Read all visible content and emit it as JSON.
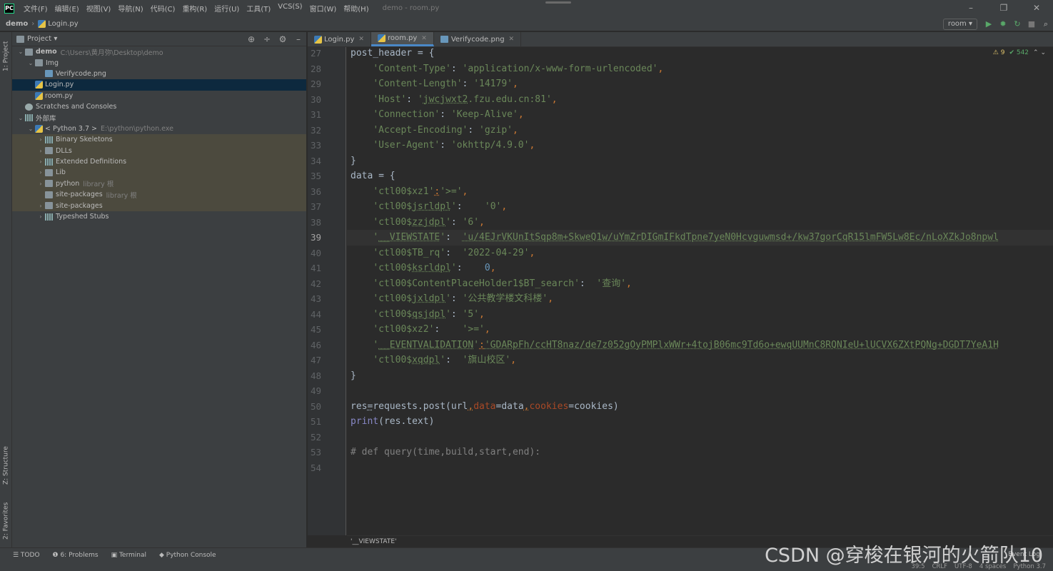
{
  "window": {
    "title": "demo - room.py",
    "menu": [
      "文件(F)",
      "编辑(E)",
      "视图(V)",
      "导航(N)",
      "代码(C)",
      "重构(R)",
      "运行(U)",
      "工具(T)",
      "VCS(S)",
      "窗口(W)",
      "帮助(H)"
    ],
    "controls": [
      "–",
      "❐",
      "✕"
    ]
  },
  "breadcrumb": {
    "project": "demo",
    "file": "Login.py"
  },
  "run": {
    "config": "room ▾",
    "buttons": [
      "▶",
      "✹",
      "↻",
      "■",
      "⌕"
    ]
  },
  "left_strip": {
    "project": "1: Project",
    "structure": "Z: Structure",
    "favorites": "2: Favorites"
  },
  "project_panel": {
    "title": "Project ▾",
    "tools": [
      "⊕",
      "÷",
      "⚙",
      "–"
    ],
    "tree": [
      {
        "indent": 0,
        "arrow": "⌄",
        "icon": "folder",
        "label": "demo",
        "path": "C:\\Users\\黄月弥\\Desktop\\demo",
        "bold": true,
        "style": ""
      },
      {
        "indent": 1,
        "arrow": "⌄",
        "icon": "folder",
        "label": "Img",
        "path": "",
        "style": ""
      },
      {
        "indent": 2,
        "arrow": "",
        "icon": "png",
        "label": "Verifycode.png",
        "path": "",
        "style": ""
      },
      {
        "indent": 1,
        "arrow": "",
        "icon": "py",
        "label": "Login.py",
        "path": "",
        "style": "selected"
      },
      {
        "indent": 1,
        "arrow": "",
        "icon": "py",
        "label": "room.py",
        "path": "",
        "style": ""
      },
      {
        "indent": 0,
        "arrow": "",
        "icon": "scratch",
        "label": "Scratches and Consoles",
        "path": "",
        "style": ""
      },
      {
        "indent": 0,
        "arrow": "⌄",
        "icon": "lib",
        "label": "外部库",
        "path": "",
        "style": ""
      },
      {
        "indent": 1,
        "arrow": "⌄",
        "icon": "py",
        "label": "< Python 3.7 >",
        "path": "E:\\python\\python.exe",
        "style": ""
      },
      {
        "indent": 2,
        "arrow": "›",
        "icon": "lib",
        "label": "Binary Skeletons",
        "path": "",
        "style": "lib"
      },
      {
        "indent": 2,
        "arrow": "›",
        "icon": "folder",
        "label": "DLLs",
        "path": "",
        "style": "lib"
      },
      {
        "indent": 2,
        "arrow": "›",
        "icon": "lib",
        "label": "Extended Definitions",
        "path": "",
        "style": "lib"
      },
      {
        "indent": 2,
        "arrow": "›",
        "icon": "folder",
        "label": "Lib",
        "path": "",
        "style": "lib"
      },
      {
        "indent": 2,
        "arrow": "›",
        "icon": "folder",
        "label": "python",
        "path": "library 根",
        "style": "lib"
      },
      {
        "indent": 2,
        "arrow": "",
        "icon": "folder",
        "label": "site-packages",
        "path": "library 根",
        "style": "lib"
      },
      {
        "indent": 2,
        "arrow": "›",
        "icon": "folder",
        "label": "site-packages",
        "path": "",
        "style": "lib"
      },
      {
        "indent": 2,
        "arrow": "›",
        "icon": "lib",
        "label": "Typeshed Stubs",
        "path": "",
        "style": ""
      }
    ]
  },
  "editor": {
    "tabs": [
      {
        "label": "Login.py",
        "active": false
      },
      {
        "label": "room.py",
        "active": true
      },
      {
        "label": "Verifycode.png",
        "active": false
      }
    ],
    "inspections": {
      "warnings": "⚠ 9",
      "ok": "✔ 542",
      "nav": "⌃ ⌄"
    },
    "current_line": 39,
    "lines": [
      {
        "n": "27",
        "html": "post_header = {"
      },
      {
        "n": "28",
        "html": "    <span class=\"s\">'Content-Type'</span>: <span class=\"s\">'application/x-www-form-urlencoded'</span><span class=\"k\">,</span>"
      },
      {
        "n": "29",
        "html": "    <span class=\"s\">'Content-Length'</span>: <span class=\"s\">'14179'</span><span class=\"k\">,</span>"
      },
      {
        "n": "30",
        "html": "    <span class=\"s\">'Host'</span>: <span class=\"s\">'<u>jwcjwxt2</u>.fzu.edu.cn:81'</span><span class=\"k\">,</span>"
      },
      {
        "n": "31",
        "html": "    <span class=\"s\">'Connection'</span>: <span class=\"s\">'Keep-Alive'</span><span class=\"k\">,</span>"
      },
      {
        "n": "32",
        "html": "    <span class=\"s\">'Accept-Encoding'</span>: <span class=\"s\">'gzip'</span><span class=\"k\">,</span>"
      },
      {
        "n": "33",
        "html": "    <span class=\"s\">'User-Agent'</span>: <span class=\"s\">'okhttp/4.9.0'</span><span class=\"k\">,</span>"
      },
      {
        "n": "34",
        "html": "}"
      },
      {
        "n": "35",
        "html": "data = {"
      },
      {
        "n": "36",
        "html": "    <span class=\"s\">'ctl00$xz1'</span><span class=\"k\"><u>:</u></span><span class=\"s\">'>='</span><span class=\"k\">,</span>"
      },
      {
        "n": "37",
        "html": "    <span class=\"s\">'ctl00$<u>jsrldpl</u>'</span>:    <span class=\"s\">'0'</span><span class=\"k\">,</span>"
      },
      {
        "n": "38",
        "html": "    <span class=\"s\">'ctl00$<u>zzjdpl</u>'</span>: <span class=\"s\">'6'</span><span class=\"k\">,</span>"
      },
      {
        "n": "39",
        "html": "    <span class=\"s\">'<u>__VIEWSTATE</u>'</span>:  <span class=\"s\"><u>'u/4EJrVKUnItSqp8m+SkweQ1w/uYmZrDIGmIFkdTpne7yeN0Hcvguwmsd+/kw37gorCqR15lmFW5Lw8Ec/nLoXZkJo8npwl</u></span>"
      },
      {
        "n": "40",
        "html": "    <span class=\"s\">'ctl00$TB_rq'</span>:  <span class=\"s\">'2022-04-29'</span><span class=\"k\">,</span>"
      },
      {
        "n": "41",
        "html": "    <span class=\"s\">'ctl00$<u>ksrldpl</u>'</span>:    <span class=\"n\">0</span><span class=\"k\">,</span>"
      },
      {
        "n": "42",
        "html": "    <span class=\"s\">'ctl00$ContentPlaceHolder1$BT_search'</span>:  <span class=\"s\">'查询'</span><span class=\"k\">,</span>"
      },
      {
        "n": "43",
        "html": "    <span class=\"s\">'ctl00$<u>jxldpl</u>'</span>: <span class=\"s\">'公共教学楼文科楼'</span><span class=\"k\">,</span>"
      },
      {
        "n": "44",
        "html": "    <span class=\"s\">'ctl00$<u>qsjdpl</u>'</span>: <span class=\"s\">'5'</span><span class=\"k\">,</span>"
      },
      {
        "n": "45",
        "html": "    <span class=\"s\">'ctl00$xz2'</span>:    <span class=\"s\">'>='</span><span class=\"k\">,</span>"
      },
      {
        "n": "46",
        "html": "    <span class=\"s\">'<u>__EVENTVALIDATION</u>'</span><span class=\"k\"><u>:</u></span><span class=\"s\"><u>'GDARpFh/ccHT8naz/de7z052gOyPMPlxWWr+4tojB06mc9Td6o+ewqUUMnC8RQNIeU+lUCVX6ZXtPQNg+DGDT7YeA1H</u></span>"
      },
      {
        "n": "47",
        "html": "    <span class=\"s\">'ctl00$<u>xqdpl</u>'</span>:  <span class=\"s\">'旗山校区'</span><span class=\"k\">,</span>"
      },
      {
        "n": "48",
        "html": "}"
      },
      {
        "n": "49",
        "html": ""
      },
      {
        "n": "50",
        "html": "res<u>=</u>requests.post(url<span class=\"k\"><u>,</u></span><span class=\"p\">data</span>=data<span class=\"k\"><u>,</u></span><span class=\"p\">cookies</span>=cookies)"
      },
      {
        "n": "51",
        "html": "<span class=\"b\">print</span>(res.text)"
      },
      {
        "n": "52",
        "html": ""
      },
      {
        "n": "53",
        "html": "<span class=\"c\"># def query(time,build,start,end):</span>"
      },
      {
        "n": "54",
        "html": ""
      }
    ],
    "crumb": "'__VIEWSTATE'"
  },
  "bottom_tools": [
    "☰ TODO",
    "❶ 6: Problems",
    "▣ Terminal",
    "◆ Python Console"
  ],
  "event_log": "Event Log",
  "status": [
    "39:5",
    "CRLF",
    "UTF-8",
    "4 spaces",
    "Python 3.7"
  ],
  "watermark": "CSDN @穿梭在银河的火箭队10"
}
